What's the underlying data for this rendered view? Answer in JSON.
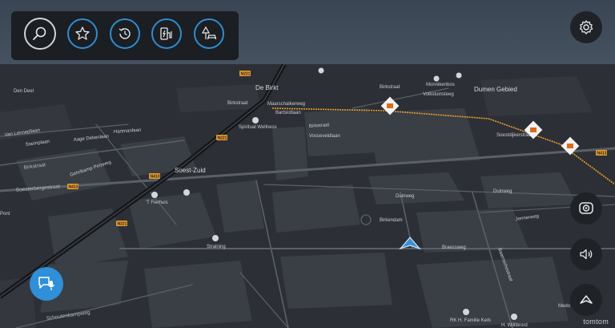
{
  "toolbar": {
    "search_icon": "search-icon",
    "favorites_icon": "star-icon",
    "recent_icon": "history-icon",
    "fuel_ev_icon": "fuel-ev-icon",
    "parks_icon": "picnic-area-icon"
  },
  "controls": {
    "settings_icon": "gear-icon",
    "camera_icon": "camera-view-icon",
    "sound_icon": "speaker-icon",
    "compass_icon": "navigation-arrow-icon",
    "voice_icon": "voice-assistant-icon"
  },
  "brand": "tomtom",
  "colors": {
    "accent": "#2f8fd8",
    "road_highlight": "#e89a2e",
    "map_bg": "#2c3036",
    "panel_bg": "#1b1e23"
  },
  "map": {
    "places": {
      "de_birkt": "De Birkt",
      "dumen_gebied": "Dumen Gebied",
      "soest_zuid": "Soest-Zuid",
      "spiritual_wellness": "Spiritual Wellness",
      "t_fierhuis": "'T Fierhuis",
      "straining": "Straining",
      "rk_kerk": "RK H. Familie Kerk",
      "h_willibrord": "H. Willibrord",
      "pont": "Pont",
      "medo": "Medo"
    },
    "streets": {
      "birkstraat": "Birkstraat",
      "soesterbergestraat": "Soesterbergestraat",
      "van_lennepllaan": "Van Lennepllaan",
      "starinplaan": "Starinplaan",
      "aage_dekenlaan": "Aage Dekenlaan",
      "hartmanlaan": "Hartmanlaan",
      "gehrlkamp": "Gehrlkamp Pelsweg",
      "schoutenkampweg": "Schoutenkampweg",
      "braessweg": "Braessweg",
      "duinweg": "Duinweg",
      "duinweg2": "Duinweg",
      "birkendam": "Birkendam",
      "jennerweg": "Jennerweg",
      "baarnschestraat": "Baarnschestraat",
      "bartslotlaan": "Bartslotlaan",
      "maarschalkerweg": "Maarschalkerweg",
      "birkstraat2": "Birkstraat",
      "vosseveldlaan": "Vosseveldlaan",
      "volkstuinsteeg": "Volkstuinsteeg",
      "monnikenbos": "Monnikenbos",
      "soestdijkerstraat": "Soestdijkerstraat",
      "birkstraat3": "Birkstraat",
      "birkstraat4": "Birkstraat",
      "den_deel": "Den Deel"
    },
    "shields": {
      "n413a": "N413",
      "n413b": "N413",
      "n221a": "N221",
      "n221b": "N221",
      "n413c": "N413",
      "n221c": "N221"
    }
  }
}
